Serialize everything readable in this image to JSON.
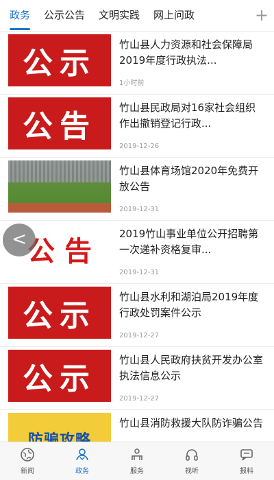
{
  "tabs": [
    {
      "label": "政务",
      "active": true
    },
    {
      "label": "公示公告",
      "active": false
    },
    {
      "label": "文明实践",
      "active": false
    },
    {
      "label": "网上问政",
      "active": false
    }
  ],
  "tab_add_icon": "plus-icon",
  "tab_add_label": "+",
  "back_label": "<",
  "articles": [
    {
      "title": "竹山县人力资源和社会保障局2019年度行政执法...",
      "date": "1小时前",
      "thumb": "公示",
      "thumb_style": "red"
    },
    {
      "title": "竹山县民政局对16家社会组织作出撤销登记行政...",
      "date": "2019-12-26",
      "thumb": "公告",
      "thumb_style": "red"
    },
    {
      "title": "竹山县体育场馆2020年免费开放公告",
      "date": "2019-12-31",
      "thumb": "",
      "thumb_style": "stadium"
    },
    {
      "title": "2019竹山事业单位公开招聘第一次递补资格复审...",
      "date": "2019-12-31",
      "thumb": "公 告",
      "thumb_style": "white"
    },
    {
      "title": "竹山县水利和湖泊局2019年度行政处罚案件公示",
      "date": "2019-12-27",
      "thumb": "公示",
      "thumb_style": "red"
    },
    {
      "title": "竹山县人民政府扶贫开发办公室执法信息公示",
      "date": "2019-12-27",
      "thumb": "公示",
      "thumb_style": "red"
    },
    {
      "title": "竹山县消防救援大队防诈骗公告",
      "date": "",
      "thumb": "防骗攻略",
      "thumb_style": "yellow"
    }
  ],
  "bottom_nav": [
    {
      "label": "新闻",
      "icon": "globe-icon",
      "active": false
    },
    {
      "label": "政务",
      "icon": "people-icon",
      "active": true
    },
    {
      "label": "服务",
      "icon": "service-icon",
      "active": false
    },
    {
      "label": "视听",
      "icon": "headphones-icon",
      "active": false
    },
    {
      "label": "报料",
      "icon": "chat-icon",
      "active": false
    }
  ],
  "colors": {
    "accent": "#1a73c9",
    "thumb_red": "#c91b1b"
  }
}
